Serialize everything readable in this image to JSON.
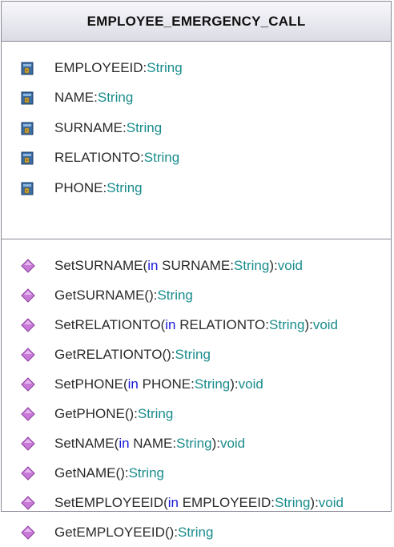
{
  "class": {
    "name": "EMPLOYEE_EMERGENCY_CALL",
    "attributes": [
      {
        "name": "EMPLOYEEID",
        "type": "String",
        "icon": "field-icon"
      },
      {
        "name": "NAME",
        "type": "String",
        "icon": "field-icon"
      },
      {
        "name": "SURNAME",
        "type": "String",
        "icon": "field-icon"
      },
      {
        "name": "RELATIONTO",
        "type": "String",
        "icon": "field-icon"
      },
      {
        "name": "PHONE",
        "type": "String",
        "icon": "field-icon"
      }
    ],
    "operations": [
      {
        "name": "SetSURNAME",
        "param_dir": "in",
        "param_name": "SURNAME",
        "param_type": "String",
        "return_type": "void",
        "icon": "method-icon"
      },
      {
        "name": "GetSURNAME",
        "return_type": "String",
        "icon": "method-icon"
      },
      {
        "name": "SetRELATIONTO",
        "param_dir": "in",
        "param_name": "RELATIONTO",
        "param_type": "String",
        "return_type": "void",
        "icon": "method-icon"
      },
      {
        "name": "GetRELATIONTO",
        "return_type": "String",
        "icon": "method-icon"
      },
      {
        "name": "SetPHONE",
        "param_dir": "in",
        "param_name": "PHONE",
        "param_type": "String",
        "return_type": "void",
        "icon": "method-icon"
      },
      {
        "name": "GetPHONE",
        "return_type": "String",
        "icon": "method-icon"
      },
      {
        "name": "SetNAME",
        "param_dir": "in",
        "param_name": "NAME",
        "param_type": "String",
        "return_type": "void",
        "icon": "method-icon"
      },
      {
        "name": "GetNAME",
        "return_type": "String",
        "icon": "method-icon"
      },
      {
        "name": "SetEMPLOYEEID",
        "param_dir": "in",
        "param_name": "EMPLOYEEID",
        "param_type": "String",
        "return_type": "void",
        "icon": "method-icon"
      },
      {
        "name": "GetEMPLOYEEID",
        "return_type": "String",
        "icon": "method-icon"
      }
    ]
  },
  "colors": {
    "name_text": "#2b2b2b",
    "type_text": "#1a8c8c",
    "keyword_text": "#1a1ad6",
    "method_icon": "#c97ad8",
    "field_icon": "#3a6ea5"
  }
}
